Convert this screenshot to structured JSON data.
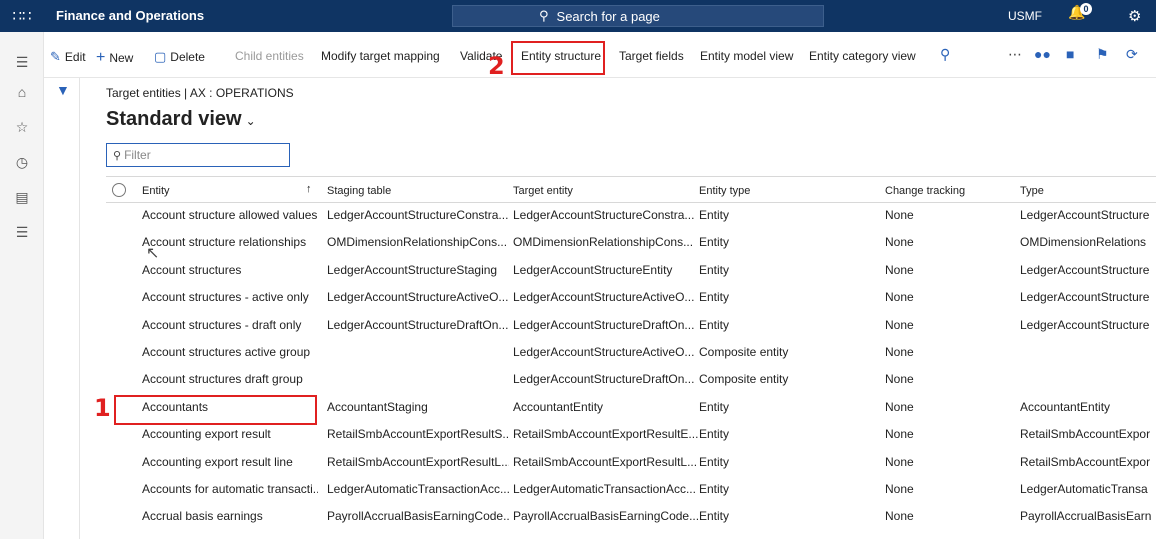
{
  "topbar": {
    "app_title": "Finance and Operations",
    "search_placeholder": "Search for a page",
    "company": "USMF",
    "notification_count": "0"
  },
  "actions": {
    "edit": "Edit",
    "new": "New",
    "delete": "Delete",
    "child_entities": "Child entities",
    "modify_target_mapping": "Modify target mapping",
    "validate": "Validate",
    "entity_structure": "Entity structure",
    "target_fields": "Target fields",
    "entity_model_view": "Entity model view",
    "entity_category_view": "Entity category view"
  },
  "annotations": {
    "step1": "1",
    "step2": "2"
  },
  "breadcrumb": "Target entities  |  AX : OPERATIONS",
  "view_title": "Standard view",
  "filter_placeholder": "Filter",
  "columns": [
    "Entity",
    "Staging table",
    "Target entity",
    "Entity type",
    "Change tracking",
    "Type"
  ],
  "rows": [
    [
      "Account structure allowed values",
      "LedgerAccountStructureConstra...",
      "LedgerAccountStructureConstra...",
      "Entity",
      "None",
      "LedgerAccountStructure"
    ],
    [
      "Account structure relationships",
      "OMDimensionRelationshipCons...",
      "OMDimensionRelationshipCons...",
      "Entity",
      "None",
      "OMDimensionRelations"
    ],
    [
      "Account structures",
      "LedgerAccountStructureStaging",
      "LedgerAccountStructureEntity",
      "Entity",
      "None",
      "LedgerAccountStructure"
    ],
    [
      "Account structures - active only",
      "LedgerAccountStructureActiveO...",
      "LedgerAccountStructureActiveO...",
      "Entity",
      "None",
      "LedgerAccountStructure"
    ],
    [
      "Account structures - draft only",
      "LedgerAccountStructureDraftOn...",
      "LedgerAccountStructureDraftOn...",
      "Entity",
      "None",
      "LedgerAccountStructure"
    ],
    [
      "Account structures active group",
      "",
      "LedgerAccountStructureActiveO...",
      "Composite entity",
      "None",
      ""
    ],
    [
      "Account structures draft group",
      "",
      "LedgerAccountStructureDraftOn...",
      "Composite entity",
      "None",
      ""
    ],
    [
      "Accountants",
      "AccountantStaging",
      "AccountantEntity",
      "Entity",
      "None",
      "AccountantEntity"
    ],
    [
      "Accounting export result",
      "RetailSmbAccountExportResultS...",
      "RetailSmbAccountExportResultE...",
      "Entity",
      "None",
      "RetailSmbAccountExpor"
    ],
    [
      "Accounting export result line",
      "RetailSmbAccountExportResultL...",
      "RetailSmbAccountExportResultL...",
      "Entity",
      "None",
      "RetailSmbAccountExpor"
    ],
    [
      "Accounts for automatic transacti...",
      "LedgerAutomaticTransactionAcc...",
      "LedgerAutomaticTransactionAcc...",
      "Entity",
      "None",
      "LedgerAutomaticTransa"
    ],
    [
      "Accrual basis earnings",
      "PayrollAccrualBasisEarningCode...",
      "PayrollAccrualBasisEarningCode...",
      "Entity",
      "None",
      "PayrollAccrualBasisEarn"
    ]
  ]
}
